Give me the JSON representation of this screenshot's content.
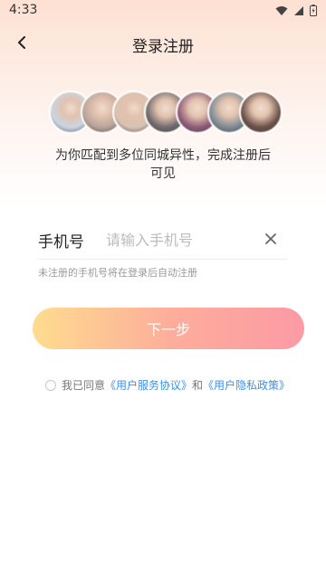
{
  "status_bar": {
    "time": "4:33",
    "icons": [
      "wifi-icon",
      "signal-icon",
      "battery-icon"
    ]
  },
  "nav": {
    "back_icon": "chevron-left-icon",
    "title": "登录注册"
  },
  "avatars": {
    "count": 7,
    "colors": [
      "#c9d6e3",
      "#b8a49b",
      "#d9c2b1",
      "#6f6a6d",
      "#8e5a78",
      "#7c8a95",
      "#6b5048"
    ]
  },
  "match_text": "为你匹配到多位同城异性，完成注册后可见",
  "phone": {
    "label": "手机号",
    "placeholder": "请输入手机号",
    "value": "",
    "clear_icon": "close-icon"
  },
  "hint": "未注册的手机号将在登录后自动注册",
  "next_button": "下一步",
  "agreement": {
    "prefix": "我已同意",
    "user_service": "《用户服务协议》",
    "and": "和",
    "privacy": "《用户隐私政策》"
  },
  "colors": {
    "link": "#3d8fe6",
    "button_start": "#fedc8f",
    "button_end": "#fc9aa5"
  }
}
